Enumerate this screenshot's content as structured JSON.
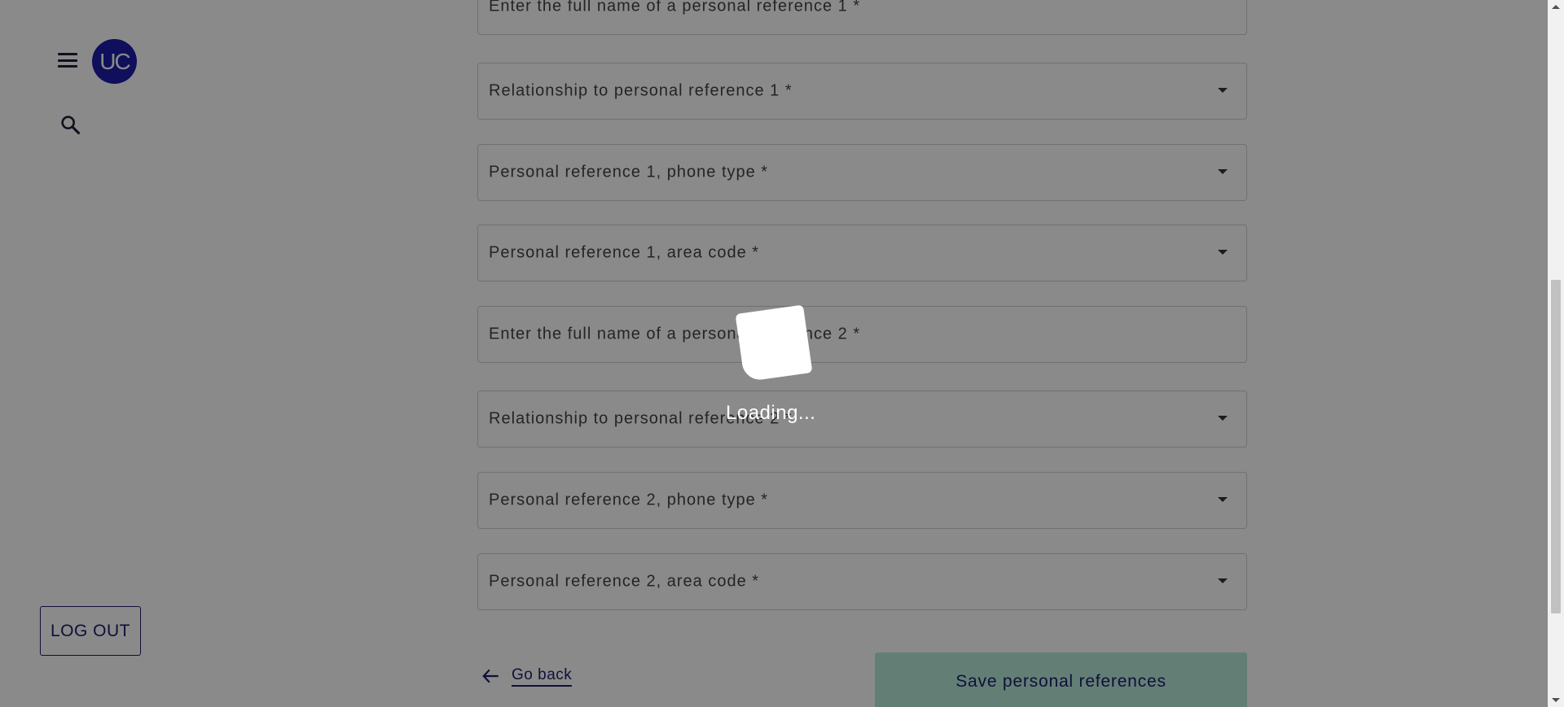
{
  "sidebar": {
    "avatar_text": "UC",
    "logout_label": "LOG OUT"
  },
  "form": {
    "fields": [
      {
        "label": "Enter the full name of a personal reference 1 *",
        "type": "text"
      },
      {
        "label": "Relationship to personal reference 1 *",
        "type": "select"
      },
      {
        "label": "Personal reference 1, phone type *",
        "type": "select"
      },
      {
        "label": "Personal reference 1, area code *",
        "type": "select"
      },
      {
        "label": "Enter the full name of a personal reference 2 *",
        "type": "text"
      },
      {
        "label": "Relationship to personal reference 2 *",
        "type": "select"
      },
      {
        "label": "Personal reference 2, phone type *",
        "type": "select"
      },
      {
        "label": "Personal reference 2, area code *",
        "type": "select"
      }
    ],
    "go_back_label": "Go back",
    "save_label": "Save personal references"
  },
  "overlay": {
    "loading_text": "Loading..."
  },
  "colors": {
    "brand_navy": "#1c1c6e",
    "avatar_bg": "#1c1ca8",
    "save_button_bg": "#b7ead8"
  },
  "icons": [
    "menu-icon",
    "search-icon",
    "arrow-left-icon",
    "chevron-down-icon"
  ]
}
